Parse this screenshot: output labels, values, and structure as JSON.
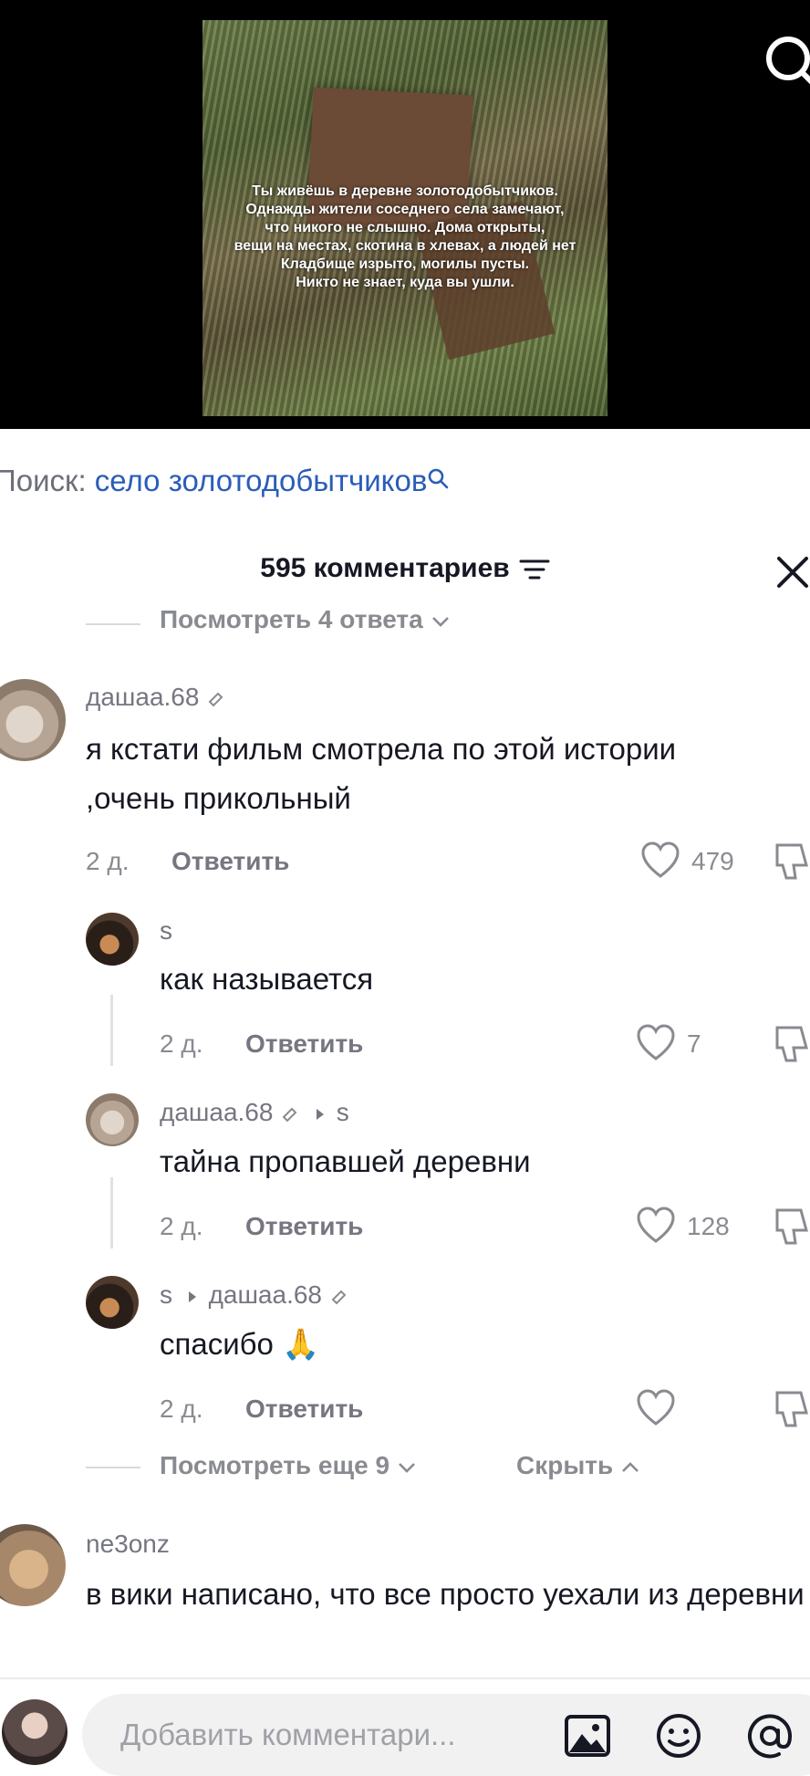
{
  "video": {
    "overlay_lines": [
      "Ты живёшь в деревне золотодобытчиков.",
      "Однажды жители соседнего села замечают,",
      "что никого не слышно. Дома открыты,",
      "вещи на местах, скотина в хлевах, а людей нет",
      "Кладбище изрыто, могилы пусты.",
      "Никто не знает, куда вы ушли."
    ]
  },
  "search_suggestion": {
    "prefix": "Поиск:",
    "query": "село золотодобытчиков"
  },
  "comments_header": {
    "count_label": "595 комментариев"
  },
  "view_replies_top": "Посмотреть 4 ответа",
  "comments": [
    {
      "username": "дашаа.68",
      "text": "я кстати фильм смотрела по этой истории ,очень прикольный",
      "time": "2 д.",
      "reply_label": "Ответить",
      "likes": "479"
    },
    {
      "username": "ne3onz",
      "text": "в вики написано, что все просто уехали из деревни"
    }
  ],
  "replies": [
    {
      "username": "s",
      "reply_to": "",
      "text": "как называется",
      "time": "2 д.",
      "reply_label": "Ответить",
      "likes": "7"
    },
    {
      "username": "дашаа.68",
      "reply_to": "s",
      "text": "тайна пропавшей деревни",
      "time": "2 д.",
      "reply_label": "Ответить",
      "likes": "128"
    },
    {
      "username": "s",
      "reply_to": "дашаа.68",
      "text": "спасибо 🙏",
      "time": "2 д.",
      "reply_label": "Ответить",
      "likes": ""
    }
  ],
  "thread_footer": {
    "view_more": "Посмотреть еще 9",
    "hide": "Скрыть"
  },
  "input": {
    "placeholder": "Добавить комментари..."
  }
}
